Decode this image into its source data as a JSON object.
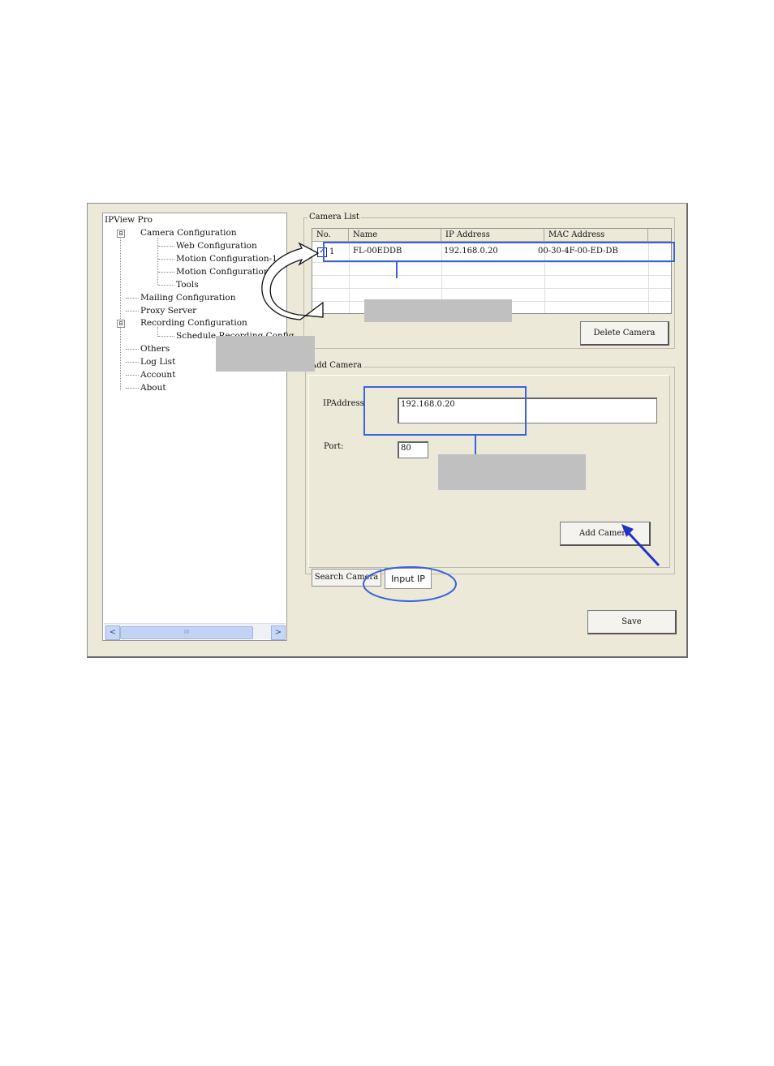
{
  "colors": {
    "highlight": "#3a63dd",
    "arrow": "#1f33c9",
    "callout": "#c0c0c0",
    "window_bg": "#ece9d8"
  },
  "tree": {
    "root": "IPView Pro",
    "camera_configuration": "Camera Configuration",
    "web_configuration": "Web Configuration",
    "motion_configuration_1": "Motion Configuration-1",
    "motion_configuration_2": "Motion Configuration-2",
    "tools": "Tools",
    "mailing_configuration": "Mailing Configuration",
    "proxy_server": "Proxy Server",
    "recording_configuration": "Recording Configuration",
    "schedule_recording_config": "Schedule Recording Config",
    "others": "Others",
    "log_list": "Log List",
    "account": "Account",
    "about": "About",
    "expander_symbol": "⊟"
  },
  "scrollbar": {
    "left_arrow": "<",
    "right_arrow": ">",
    "grip": "III"
  },
  "camera_list": {
    "title": "Camera List",
    "columns": [
      "No.",
      "Name",
      "IP Address",
      "MAC Address"
    ],
    "rows": [
      {
        "checked": true,
        "no": "1",
        "name": "FL-00EDDB",
        "ip": "192.168.0.20",
        "mac": "00-30-4F-00-ED-DB"
      }
    ],
    "check_mark": "✓",
    "delete_button": "Delete Camera"
  },
  "add_camera": {
    "title": "Add Camera",
    "ip_label": "IPAddress",
    "ip_value": "192.168.0.20",
    "port_label": "Port:",
    "port_value": "80",
    "add_button": "Add Camera"
  },
  "tabs": {
    "search_camera": "Search Camera",
    "input_ip": "Input IP"
  },
  "save_button": "Save"
}
